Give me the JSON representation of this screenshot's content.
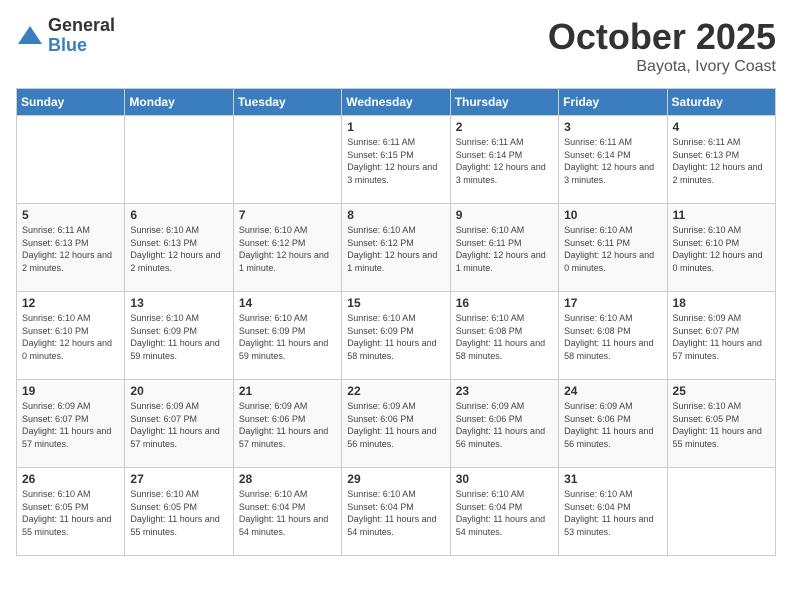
{
  "header": {
    "logo_general": "General",
    "logo_blue": "Blue",
    "month": "October 2025",
    "location": "Bayota, Ivory Coast"
  },
  "weekdays": [
    "Sunday",
    "Monday",
    "Tuesday",
    "Wednesday",
    "Thursday",
    "Friday",
    "Saturday"
  ],
  "weeks": [
    [
      {
        "day": "",
        "info": ""
      },
      {
        "day": "",
        "info": ""
      },
      {
        "day": "",
        "info": ""
      },
      {
        "day": "1",
        "info": "Sunrise: 6:11 AM\nSunset: 6:15 PM\nDaylight: 12 hours and 3 minutes."
      },
      {
        "day": "2",
        "info": "Sunrise: 6:11 AM\nSunset: 6:14 PM\nDaylight: 12 hours and 3 minutes."
      },
      {
        "day": "3",
        "info": "Sunrise: 6:11 AM\nSunset: 6:14 PM\nDaylight: 12 hours and 3 minutes."
      },
      {
        "day": "4",
        "info": "Sunrise: 6:11 AM\nSunset: 6:13 PM\nDaylight: 12 hours and 2 minutes."
      }
    ],
    [
      {
        "day": "5",
        "info": "Sunrise: 6:11 AM\nSunset: 6:13 PM\nDaylight: 12 hours and 2 minutes."
      },
      {
        "day": "6",
        "info": "Sunrise: 6:10 AM\nSunset: 6:13 PM\nDaylight: 12 hours and 2 minutes."
      },
      {
        "day": "7",
        "info": "Sunrise: 6:10 AM\nSunset: 6:12 PM\nDaylight: 12 hours and 1 minute."
      },
      {
        "day": "8",
        "info": "Sunrise: 6:10 AM\nSunset: 6:12 PM\nDaylight: 12 hours and 1 minute."
      },
      {
        "day": "9",
        "info": "Sunrise: 6:10 AM\nSunset: 6:11 PM\nDaylight: 12 hours and 1 minute."
      },
      {
        "day": "10",
        "info": "Sunrise: 6:10 AM\nSunset: 6:11 PM\nDaylight: 12 hours and 0 minutes."
      },
      {
        "day": "11",
        "info": "Sunrise: 6:10 AM\nSunset: 6:10 PM\nDaylight: 12 hours and 0 minutes."
      }
    ],
    [
      {
        "day": "12",
        "info": "Sunrise: 6:10 AM\nSunset: 6:10 PM\nDaylight: 12 hours and 0 minutes."
      },
      {
        "day": "13",
        "info": "Sunrise: 6:10 AM\nSunset: 6:09 PM\nDaylight: 11 hours and 59 minutes."
      },
      {
        "day": "14",
        "info": "Sunrise: 6:10 AM\nSunset: 6:09 PM\nDaylight: 11 hours and 59 minutes."
      },
      {
        "day": "15",
        "info": "Sunrise: 6:10 AM\nSunset: 6:09 PM\nDaylight: 11 hours and 58 minutes."
      },
      {
        "day": "16",
        "info": "Sunrise: 6:10 AM\nSunset: 6:08 PM\nDaylight: 11 hours and 58 minutes."
      },
      {
        "day": "17",
        "info": "Sunrise: 6:10 AM\nSunset: 6:08 PM\nDaylight: 11 hours and 58 minutes."
      },
      {
        "day": "18",
        "info": "Sunrise: 6:09 AM\nSunset: 6:07 PM\nDaylight: 11 hours and 57 minutes."
      }
    ],
    [
      {
        "day": "19",
        "info": "Sunrise: 6:09 AM\nSunset: 6:07 PM\nDaylight: 11 hours and 57 minutes."
      },
      {
        "day": "20",
        "info": "Sunrise: 6:09 AM\nSunset: 6:07 PM\nDaylight: 11 hours and 57 minutes."
      },
      {
        "day": "21",
        "info": "Sunrise: 6:09 AM\nSunset: 6:06 PM\nDaylight: 11 hours and 57 minutes."
      },
      {
        "day": "22",
        "info": "Sunrise: 6:09 AM\nSunset: 6:06 PM\nDaylight: 11 hours and 56 minutes."
      },
      {
        "day": "23",
        "info": "Sunrise: 6:09 AM\nSunset: 6:06 PM\nDaylight: 11 hours and 56 minutes."
      },
      {
        "day": "24",
        "info": "Sunrise: 6:09 AM\nSunset: 6:06 PM\nDaylight: 11 hours and 56 minutes."
      },
      {
        "day": "25",
        "info": "Sunrise: 6:10 AM\nSunset: 6:05 PM\nDaylight: 11 hours and 55 minutes."
      }
    ],
    [
      {
        "day": "26",
        "info": "Sunrise: 6:10 AM\nSunset: 6:05 PM\nDaylight: 11 hours and 55 minutes."
      },
      {
        "day": "27",
        "info": "Sunrise: 6:10 AM\nSunset: 6:05 PM\nDaylight: 11 hours and 55 minutes."
      },
      {
        "day": "28",
        "info": "Sunrise: 6:10 AM\nSunset: 6:04 PM\nDaylight: 11 hours and 54 minutes."
      },
      {
        "day": "29",
        "info": "Sunrise: 6:10 AM\nSunset: 6:04 PM\nDaylight: 11 hours and 54 minutes."
      },
      {
        "day": "30",
        "info": "Sunrise: 6:10 AM\nSunset: 6:04 PM\nDaylight: 11 hours and 54 minutes."
      },
      {
        "day": "31",
        "info": "Sunrise: 6:10 AM\nSunset: 6:04 PM\nDaylight: 11 hours and 53 minutes."
      },
      {
        "day": "",
        "info": ""
      }
    ]
  ]
}
